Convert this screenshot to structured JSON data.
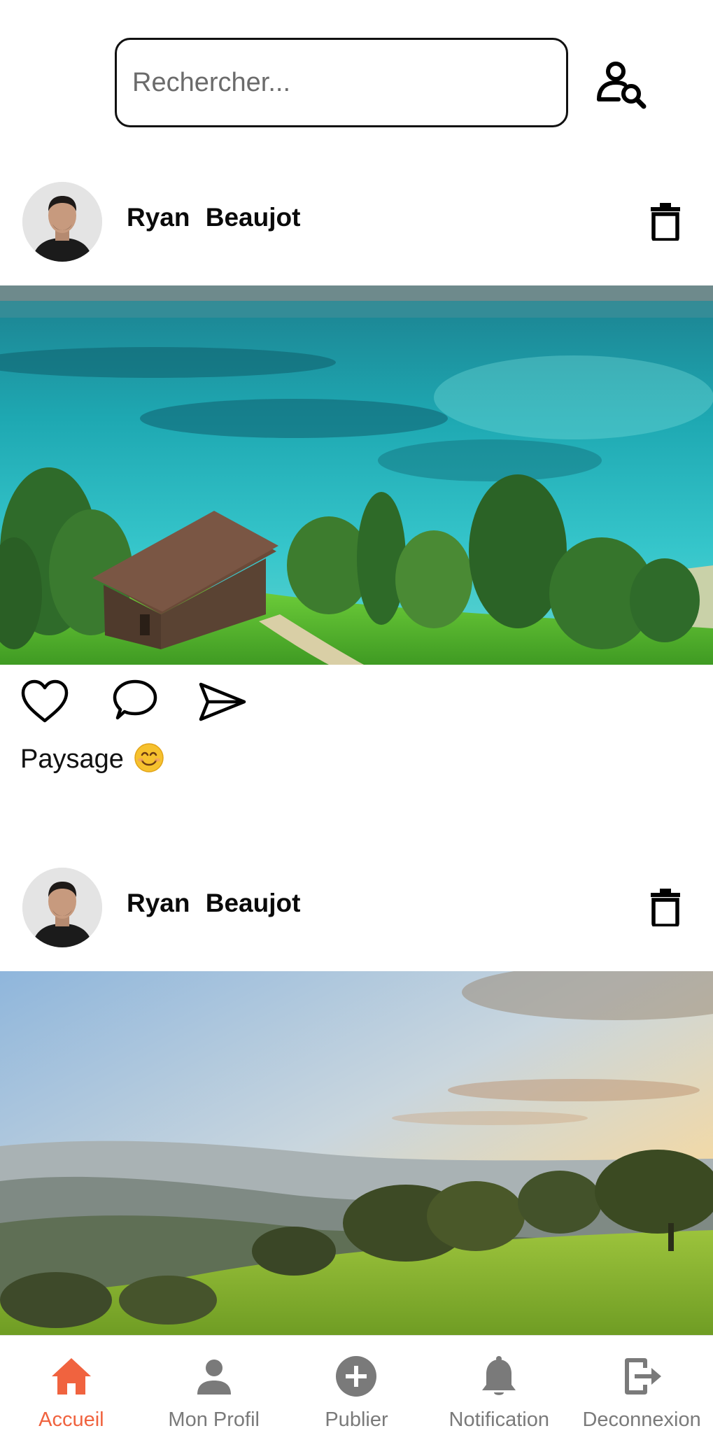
{
  "search": {
    "placeholder": "Rechercher..."
  },
  "posts": [
    {
      "author": "Ryan  Beaujot",
      "image_description_icon": "lake-landscape-photo",
      "caption": "Paysage",
      "caption_emoji": "smiling-face-emoji"
    },
    {
      "author": "Ryan  Beaujot",
      "image_description_icon": "sunset-hills-photo",
      "caption": ""
    }
  ],
  "nav": {
    "items": [
      {
        "label": "Accueil",
        "icon": "home-icon",
        "active": true
      },
      {
        "label": "Mon Profil",
        "icon": "person-icon",
        "active": false
      },
      {
        "label": "Publier",
        "icon": "add-circle-icon",
        "active": false
      },
      {
        "label": "Notification",
        "icon": "bell-icon",
        "active": false
      },
      {
        "label": "Deconnexion",
        "icon": "logout-icon",
        "active": false
      }
    ]
  },
  "colors": {
    "accent": "#f0633f",
    "nav_inactive": "#7a7a7a",
    "text": "#0a0a0a"
  }
}
